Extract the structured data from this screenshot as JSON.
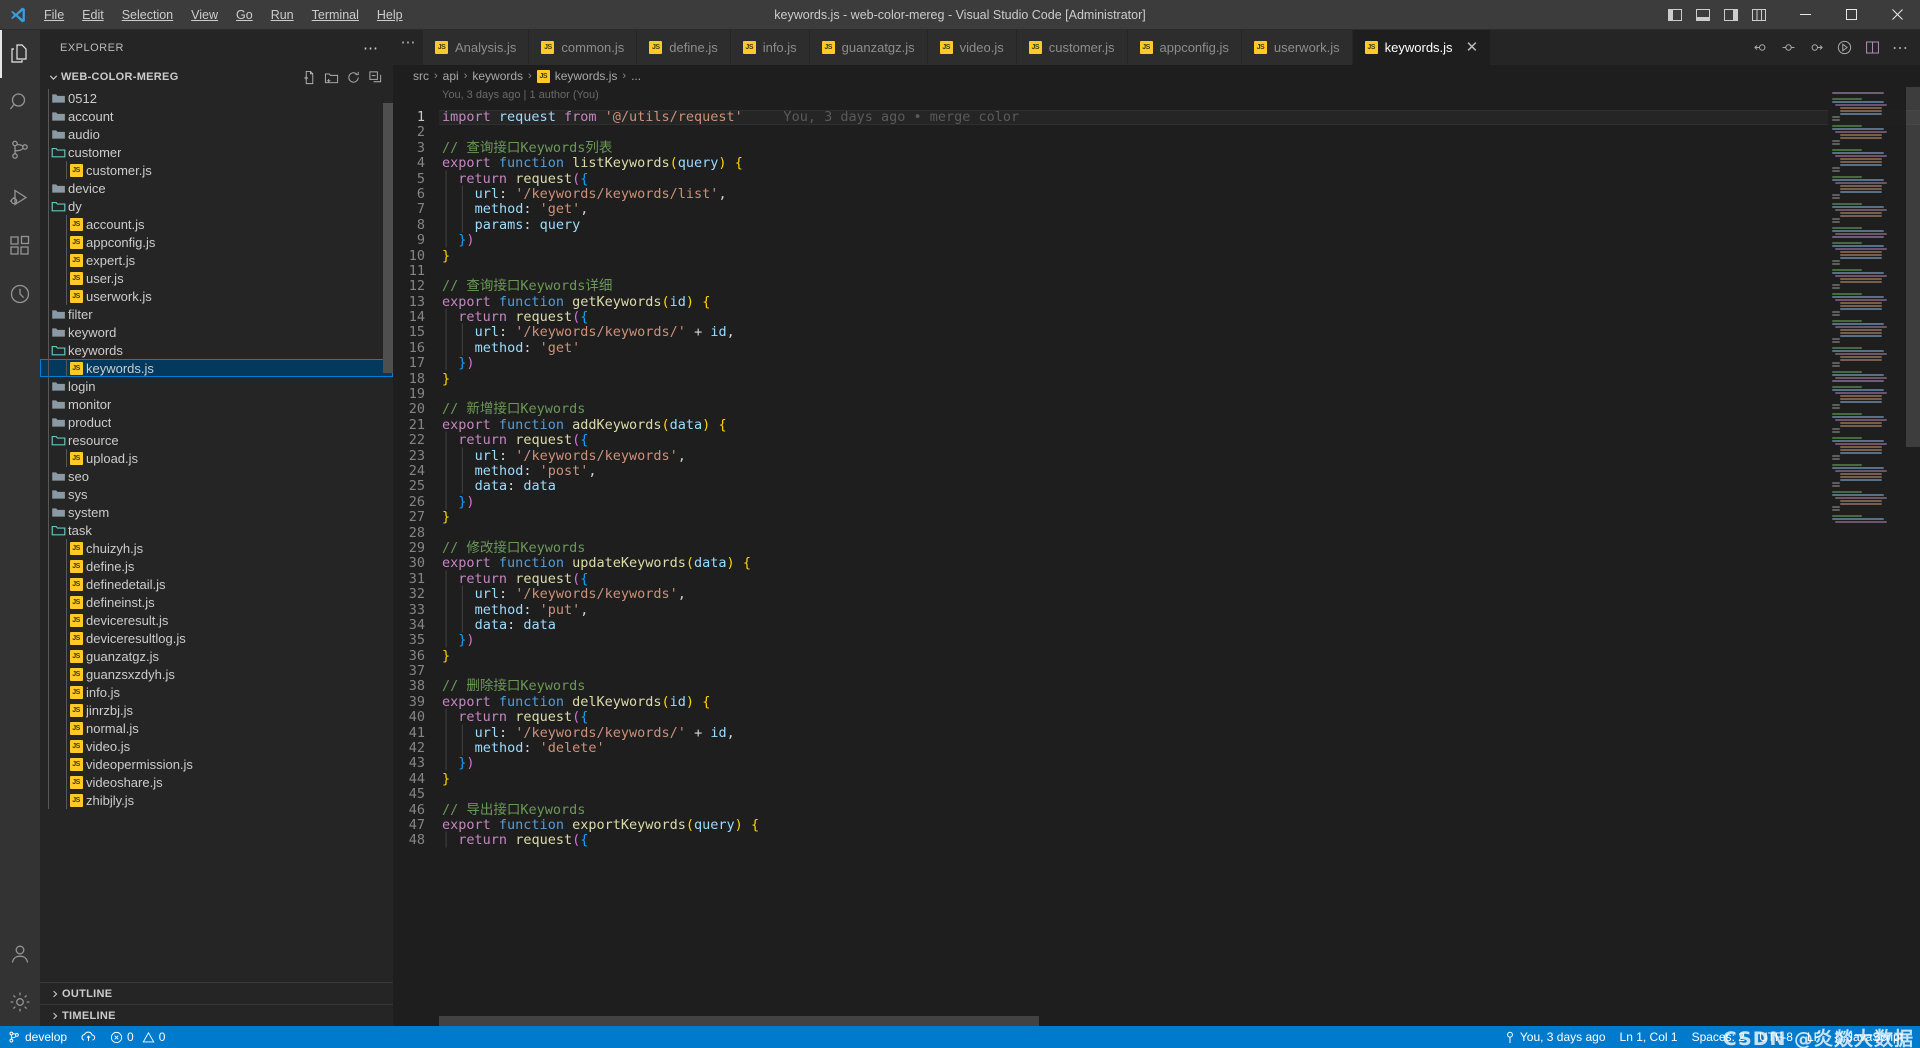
{
  "window": {
    "title": "keywords.js - web-color-mereg - Visual Studio Code [Administrator]",
    "minimize": "─",
    "maximize": "□",
    "close": "✕"
  },
  "menu": {
    "items": [
      "File",
      "Edit",
      "Selection",
      "View",
      "Go",
      "Run",
      "Terminal",
      "Help"
    ]
  },
  "activitybar": {
    "items": [
      {
        "name": "explorer",
        "active": true
      },
      {
        "name": "search",
        "active": false
      },
      {
        "name": "source-control",
        "active": false
      },
      {
        "name": "run-and-debug",
        "active": false
      },
      {
        "name": "extensions",
        "active": false
      },
      {
        "name": "timeline-clock",
        "active": false
      }
    ],
    "bottom": [
      {
        "name": "accounts"
      },
      {
        "name": "manage-settings"
      }
    ]
  },
  "sidebar": {
    "header": "EXPLORER",
    "header_more": "⋯",
    "folder": "WEB-COLOR-MEREG",
    "folder_actions": [
      "new-file",
      "new-folder",
      "refresh",
      "collapse-all"
    ],
    "tree": [
      {
        "label": "0512",
        "type": "folder",
        "depth": 1,
        "open": false
      },
      {
        "label": "account",
        "type": "folder",
        "depth": 1,
        "open": false
      },
      {
        "label": "audio",
        "type": "folder",
        "depth": 1,
        "open": false
      },
      {
        "label": "customer",
        "type": "folder",
        "depth": 1,
        "open": true
      },
      {
        "label": "customer.js",
        "type": "js",
        "depth": 2
      },
      {
        "label": "device",
        "type": "folder",
        "depth": 1,
        "open": false
      },
      {
        "label": "dy",
        "type": "folder",
        "depth": 1,
        "open": true
      },
      {
        "label": "account.js",
        "type": "js",
        "depth": 2
      },
      {
        "label": "appconfig.js",
        "type": "js",
        "depth": 2
      },
      {
        "label": "expert.js",
        "type": "js",
        "depth": 2
      },
      {
        "label": "user.js",
        "type": "js",
        "depth": 2
      },
      {
        "label": "userwork.js",
        "type": "js",
        "depth": 2
      },
      {
        "label": "filter",
        "type": "folder",
        "depth": 1,
        "open": false
      },
      {
        "label": "keyword",
        "type": "folder",
        "depth": 1,
        "open": false
      },
      {
        "label": "keywords",
        "type": "folder",
        "depth": 1,
        "open": true
      },
      {
        "label": "keywords.js",
        "type": "js",
        "depth": 2,
        "selected": true
      },
      {
        "label": "login",
        "type": "folder",
        "depth": 1,
        "open": false
      },
      {
        "label": "monitor",
        "type": "folder",
        "depth": 1,
        "open": false
      },
      {
        "label": "product",
        "type": "folder",
        "depth": 1,
        "open": false
      },
      {
        "label": "resource",
        "type": "folder",
        "depth": 1,
        "open": true
      },
      {
        "label": "upload.js",
        "type": "js",
        "depth": 2
      },
      {
        "label": "seo",
        "type": "folder",
        "depth": 1,
        "open": false
      },
      {
        "label": "sys",
        "type": "folder",
        "depth": 1,
        "open": false
      },
      {
        "label": "system",
        "type": "folder",
        "depth": 1,
        "open": false
      },
      {
        "label": "task",
        "type": "folder",
        "depth": 1,
        "open": true
      },
      {
        "label": "chuizyh.js",
        "type": "js",
        "depth": 2
      },
      {
        "label": "define.js",
        "type": "js",
        "depth": 2
      },
      {
        "label": "definedetail.js",
        "type": "js",
        "depth": 2
      },
      {
        "label": "defineinst.js",
        "type": "js",
        "depth": 2
      },
      {
        "label": "deviceresult.js",
        "type": "js",
        "depth": 2
      },
      {
        "label": "deviceresultlog.js",
        "type": "js",
        "depth": 2
      },
      {
        "label": "guanzatgz.js",
        "type": "js",
        "depth": 2
      },
      {
        "label": "guanzsxzdyh.js",
        "type": "js",
        "depth": 2
      },
      {
        "label": "info.js",
        "type": "js",
        "depth": 2
      },
      {
        "label": "jinrzbj.js",
        "type": "js",
        "depth": 2
      },
      {
        "label": "normal.js",
        "type": "js",
        "depth": 2
      },
      {
        "label": "video.js",
        "type": "js",
        "depth": 2
      },
      {
        "label": "videopermission.js",
        "type": "js",
        "depth": 2
      },
      {
        "label": "videoshare.js",
        "type": "js",
        "depth": 2
      },
      {
        "label": "zhibjly.js",
        "type": "js",
        "depth": 2
      }
    ],
    "panels": [
      {
        "label": "OUTLINE"
      },
      {
        "label": "TIMELINE"
      }
    ]
  },
  "tabs": {
    "overflow": "⋯",
    "items": [
      {
        "label": "Analysis.js",
        "active": false
      },
      {
        "label": "common.js",
        "active": false
      },
      {
        "label": "define.js",
        "active": false
      },
      {
        "label": "info.js",
        "active": false
      },
      {
        "label": "guanzatgz.js",
        "active": false
      },
      {
        "label": "video.js",
        "active": false
      },
      {
        "label": "customer.js",
        "active": false
      },
      {
        "label": "appconfig.js",
        "active": false
      },
      {
        "label": "userwork.js",
        "active": false
      },
      {
        "label": "keywords.js",
        "active": true,
        "close": "✕"
      }
    ],
    "actions": [
      "go-back-change",
      "go-to-change",
      "go-forward-change",
      "run-file",
      "split-editor",
      "more-actions"
    ]
  },
  "breadcrumb": {
    "items": [
      "src",
      "api",
      "keywords",
      "keywords.js",
      "..."
    ],
    "separator": "›",
    "file_index": 3
  },
  "editor": {
    "blame_header": "You, 3 days ago | 1 author (You)",
    "inline_blame": "You, 3 days ago • merge color",
    "first_line": 1,
    "last_line": 48,
    "code": [
      {
        "n": 1,
        "t": "import-request"
      },
      {
        "n": 2,
        "t": "blank"
      },
      {
        "n": 3,
        "t": "comment",
        "text": "// 查询接口Keywords列表"
      },
      {
        "n": 4,
        "t": "export-fn",
        "fn": "listKeywords",
        "arg": "query"
      },
      {
        "n": 5,
        "t": "return-request"
      },
      {
        "n": 6,
        "t": "prop-str",
        "key": "url",
        "val": "'/keywords/keywords/list'",
        "comma": ","
      },
      {
        "n": 7,
        "t": "prop-str",
        "key": "method",
        "val": "'get'",
        "comma": ","
      },
      {
        "n": 8,
        "t": "prop-id",
        "key": "params",
        "val": "query",
        "comma": ""
      },
      {
        "n": 9,
        "t": "close-obj"
      },
      {
        "n": 10,
        "t": "close-fn"
      },
      {
        "n": 11,
        "t": "blank"
      },
      {
        "n": 12,
        "t": "comment",
        "text": "// 查询接口Keywords详细"
      },
      {
        "n": 13,
        "t": "export-fn",
        "fn": "getKeywords",
        "arg": "id"
      },
      {
        "n": 14,
        "t": "return-request"
      },
      {
        "n": 15,
        "t": "prop-concat",
        "key": "url",
        "val": "'/keywords/keywords/'",
        "plus": "+",
        "id": "id",
        "comma": ","
      },
      {
        "n": 16,
        "t": "prop-str",
        "key": "method",
        "val": "'get'",
        "comma": ""
      },
      {
        "n": 17,
        "t": "close-obj"
      },
      {
        "n": 18,
        "t": "close-fn"
      },
      {
        "n": 19,
        "t": "blank"
      },
      {
        "n": 20,
        "t": "comment",
        "text": "// 新增接口Keywords"
      },
      {
        "n": 21,
        "t": "export-fn",
        "fn": "addKeywords",
        "arg": "data"
      },
      {
        "n": 22,
        "t": "return-request"
      },
      {
        "n": 23,
        "t": "prop-str",
        "key": "url",
        "val": "'/keywords/keywords'",
        "comma": ","
      },
      {
        "n": 24,
        "t": "prop-str",
        "key": "method",
        "val": "'post'",
        "comma": ","
      },
      {
        "n": 25,
        "t": "prop-id",
        "key": "data",
        "val": "data",
        "comma": ""
      },
      {
        "n": 26,
        "t": "close-obj"
      },
      {
        "n": 27,
        "t": "close-fn"
      },
      {
        "n": 28,
        "t": "blank"
      },
      {
        "n": 29,
        "t": "comment",
        "text": "// 修改接口Keywords"
      },
      {
        "n": 30,
        "t": "export-fn",
        "fn": "updateKeywords",
        "arg": "data"
      },
      {
        "n": 31,
        "t": "return-request"
      },
      {
        "n": 32,
        "t": "prop-str",
        "key": "url",
        "val": "'/keywords/keywords'",
        "comma": ","
      },
      {
        "n": 33,
        "t": "prop-str",
        "key": "method",
        "val": "'put'",
        "comma": ","
      },
      {
        "n": 34,
        "t": "prop-id",
        "key": "data",
        "val": "data",
        "comma": ""
      },
      {
        "n": 35,
        "t": "close-obj"
      },
      {
        "n": 36,
        "t": "close-fn"
      },
      {
        "n": 37,
        "t": "blank"
      },
      {
        "n": 38,
        "t": "comment",
        "text": "// 删除接口Keywords"
      },
      {
        "n": 39,
        "t": "export-fn",
        "fn": "delKeywords",
        "arg": "id"
      },
      {
        "n": 40,
        "t": "return-request"
      },
      {
        "n": 41,
        "t": "prop-concat",
        "key": "url",
        "val": "'/keywords/keywords/'",
        "plus": "+",
        "id": "id",
        "comma": ","
      },
      {
        "n": 42,
        "t": "prop-str",
        "key": "method",
        "val": "'delete'",
        "comma": ""
      },
      {
        "n": 43,
        "t": "close-obj"
      },
      {
        "n": 44,
        "t": "close-fn"
      },
      {
        "n": 45,
        "t": "blank"
      },
      {
        "n": 46,
        "t": "comment",
        "text": "// 导出接口Keywords"
      },
      {
        "n": 47,
        "t": "export-fn",
        "fn": "exportKeywords",
        "arg": "query"
      },
      {
        "n": 48,
        "t": "return-request"
      }
    ]
  },
  "statusbar": {
    "branch": "develop",
    "sync_icon": "sync-icon",
    "errors": "0",
    "warnings": "0",
    "blame": "You, 3 days ago",
    "position": "Ln 1, Col 1",
    "indent": "Spaces: 2",
    "encoding": "UTF-8",
    "eol": "LF",
    "language": "JavaScript",
    "lang_prefix": "{}",
    "watermark": "CSDN @炎燚大数据"
  },
  "colors": {
    "accent": "#007acc",
    "selection": "#04395e",
    "selection_border": "#007fd4",
    "editor_bg": "#1e1e1e",
    "sidebar_bg": "#252526",
    "activity_bg": "#333333",
    "title_bg": "#3c3c3c",
    "js_badge": "#ffca28",
    "folder_open": "#62c8c0",
    "folder_closed": "#8a9aa4"
  }
}
